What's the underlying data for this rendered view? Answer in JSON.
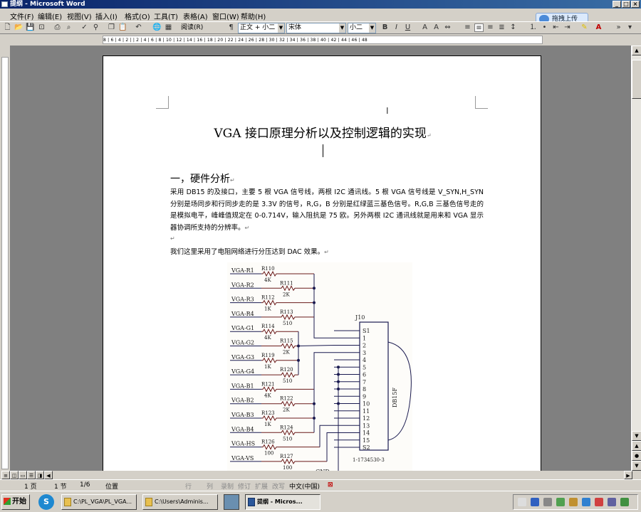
{
  "window": {
    "title": "提纲 - Microsoft Word",
    "buttons": [
      "_",
      "□",
      "×"
    ]
  },
  "menu": [
    "文件(F)",
    "编辑(E)",
    "视图(V)",
    "插入(I)",
    "格式(O)",
    "工具(T)",
    "表格(A)",
    "窗口(W)",
    "帮助(H)"
  ],
  "toolbar": {
    "read_label": "阅读(R)",
    "style": "正文 + 小二",
    "font": "宋体",
    "size": "小二",
    "bold": "B",
    "italic": "I",
    "underline": "U",
    "font_color_letter": "A"
  },
  "upload_popup": "拖拽上传",
  "ruler_numbers": "8 | 6 | 4 | 2 |   | 2 | 4 | 6 | 8 | 10 | 12 | 14 | 16 | 18 | 20 | 22 | 24 | 26 | 28 | 30 | 32 | 34 | 36 | 38 | 40 | 42 | 44 | 46 | 48",
  "document": {
    "title": "VGA 接口原理分析以及控制逻辑的实现",
    "heading1": "一，硬件分析",
    "paragraph1": "采用 DB15 的及接口，主要 5 根 VGA 信号线，两根 I2C 通讯线。5 根 VGA 信号线是 V_SYN,H_SYN 分别是场同步和行同步走的是 3.3V 的信号，R,G，B 分别是红绿蓝三基色信号。R,G,B 三基色信号走的是模拟电平，峰峰值规定在 0-0.714V，输入阻抗是 75 欧。另外两根 I2C 通讯线就是用来和 VGA 显示器协调所支持的分辨率。",
    "paragraph2": "我们这里采用了电阻网络进行分压达到 DAC 效果。",
    "para_mark": "↵"
  },
  "schematic": {
    "signals": [
      "VGA-R1",
      "VGA-R2",
      "VGA-R3",
      "VGA-R4",
      "VGA-G1",
      "VGA-G2",
      "VGA-G3",
      "VGA-G4",
      "VGA-B1",
      "VGA-B2",
      "VGA-B3",
      "VGA-B4",
      "VGA-HS",
      "VGA-VS"
    ],
    "resistors": [
      {
        "ref": "R110",
        "val": "4K"
      },
      {
        "ref": "R111",
        "val": "2K"
      },
      {
        "ref": "R112",
        "val": "1K"
      },
      {
        "ref": "R113",
        "val": "510"
      },
      {
        "ref": "R114",
        "val": "4K"
      },
      {
        "ref": "R115",
        "val": "2K"
      },
      {
        "ref": "R119",
        "val": "1K"
      },
      {
        "ref": "R120",
        "val": "510"
      },
      {
        "ref": "R121",
        "val": "4K"
      },
      {
        "ref": "R122",
        "val": "2K"
      },
      {
        "ref": "R123",
        "val": "1K"
      },
      {
        "ref": "R124",
        "val": "510"
      },
      {
        "ref": "R126",
        "val": "100"
      },
      {
        "ref": "R127",
        "val": "100"
      }
    ],
    "connector_ref": "J10",
    "connector_type": "DB15F",
    "connector_part": "1-1734530-3",
    "pins": [
      "S1",
      "1",
      "2",
      "3",
      "4",
      "5",
      "6",
      "7",
      "8",
      "9",
      "10",
      "11",
      "12",
      "13",
      "14",
      "15",
      "S2"
    ],
    "gnd": "GND"
  },
  "status": {
    "page": "1 页",
    "section": "1 节",
    "pages": "1/6",
    "position": "位置",
    "line": "行",
    "col": "列",
    "rec": "录制",
    "trk": "修订",
    "ext": "扩展",
    "ovr": "改写",
    "lang": "中文(中国)"
  },
  "taskbar": {
    "start": "开始",
    "tasks": [
      "C:\\PL_VGA\\PL_VGA...",
      "C:\\Users\\Adminis...",
      "提纲 - Micros..."
    ]
  }
}
